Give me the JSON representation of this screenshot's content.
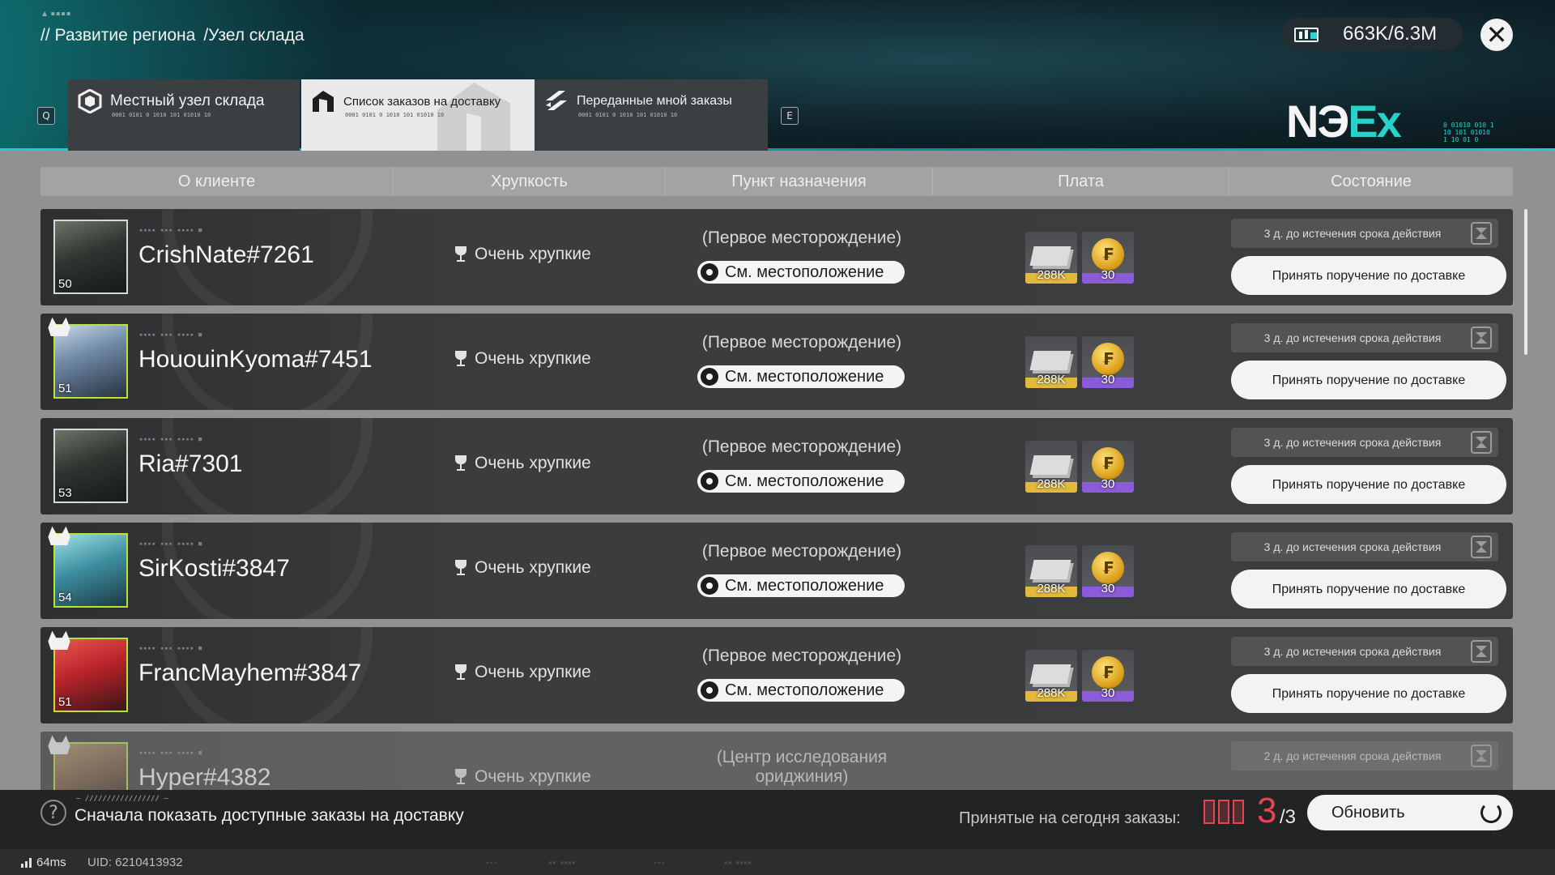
{
  "breadcrumb": {
    "part1": "// Развитие региона",
    "part2": "/Узел склада"
  },
  "currency": {
    "value": "663K/6.3M",
    "icon": "storage-capacity-icon"
  },
  "brand": {
    "main": "NЭ",
    "accent": "Ex"
  },
  "tabs": [
    {
      "label": "Местный узел склада",
      "code": "0001 0101 0 1010 101 01010 10"
    },
    {
      "label": "Список заказов на доставку",
      "code": "0001 0101 0 1010 101 01010 10"
    },
    {
      "label": "Переданные мной заказы",
      "code": "0001 0101 0 1010 101 01010 10"
    }
  ],
  "key_hints": {
    "left": "Q",
    "right": "E"
  },
  "columns": [
    "О клиенте",
    "Хрупкость",
    "Пункт назначения",
    "Плата",
    "Состояние"
  ],
  "orders": [
    {
      "name": "CrishNate#7261",
      "level": "50",
      "fragility": "Очень хрупкие",
      "destination": "(Первое месторождение)",
      "location_btn": "См. местоположение",
      "reward1": "288K",
      "reward2": "30",
      "expiry": "3 д. до истечения срока действия",
      "accept": "Принять поручение по доставке"
    },
    {
      "name": "HououinKyoma#7451",
      "level": "51",
      "fragility": "Очень хрупкие",
      "destination": "(Первое месторождение)",
      "location_btn": "См. местоположение",
      "reward1": "288K",
      "reward2": "30",
      "expiry": "3 д. до истечения срока действия",
      "accept": "Принять поручение по доставке"
    },
    {
      "name": "Ria#7301",
      "level": "53",
      "fragility": "Очень хрупкие",
      "destination": "(Первое месторождение)",
      "location_btn": "См. местоположение",
      "reward1": "288K",
      "reward2": "30",
      "expiry": "3 д. до истечения срока действия",
      "accept": "Принять поручение по доставке"
    },
    {
      "name": "SirKosti#3847",
      "level": "54",
      "fragility": "Очень хрупкие",
      "destination": "(Первое месторождение)",
      "location_btn": "См. местоположение",
      "reward1": "288K",
      "reward2": "30",
      "expiry": "3 д. до истечения срока действия",
      "accept": "Принять поручение по доставке"
    },
    {
      "name": "FrancMayhem#3847",
      "level": "51",
      "fragility": "Очень хрупкие",
      "destination": "(Первое месторождение)",
      "location_btn": "См. местоположение",
      "reward1": "288K",
      "reward2": "30",
      "expiry": "3 д. до истечения срока действия",
      "accept": "Принять поручение по доставке"
    },
    {
      "name": "Hyper#4382",
      "fragility": "Очень хрупкие",
      "destination": "(Центр исследования ориджиния)",
      "expiry": "2 д. до истечения срока действия"
    }
  ],
  "bottom": {
    "hint": "Сначала показать доступные заказы на доставку",
    "today_label": "Принятые на сегодня заказы:",
    "today_count": "3",
    "today_total": "/3",
    "refresh": "Обновить"
  },
  "status": {
    "ping": "64ms",
    "uid": "UID: 6210413932"
  },
  "colors": {
    "accent": "#27d3c9",
    "alert": "#e2464f",
    "reward_gold": "#e2b93b",
    "reward_purple": "#8b5bd9"
  }
}
